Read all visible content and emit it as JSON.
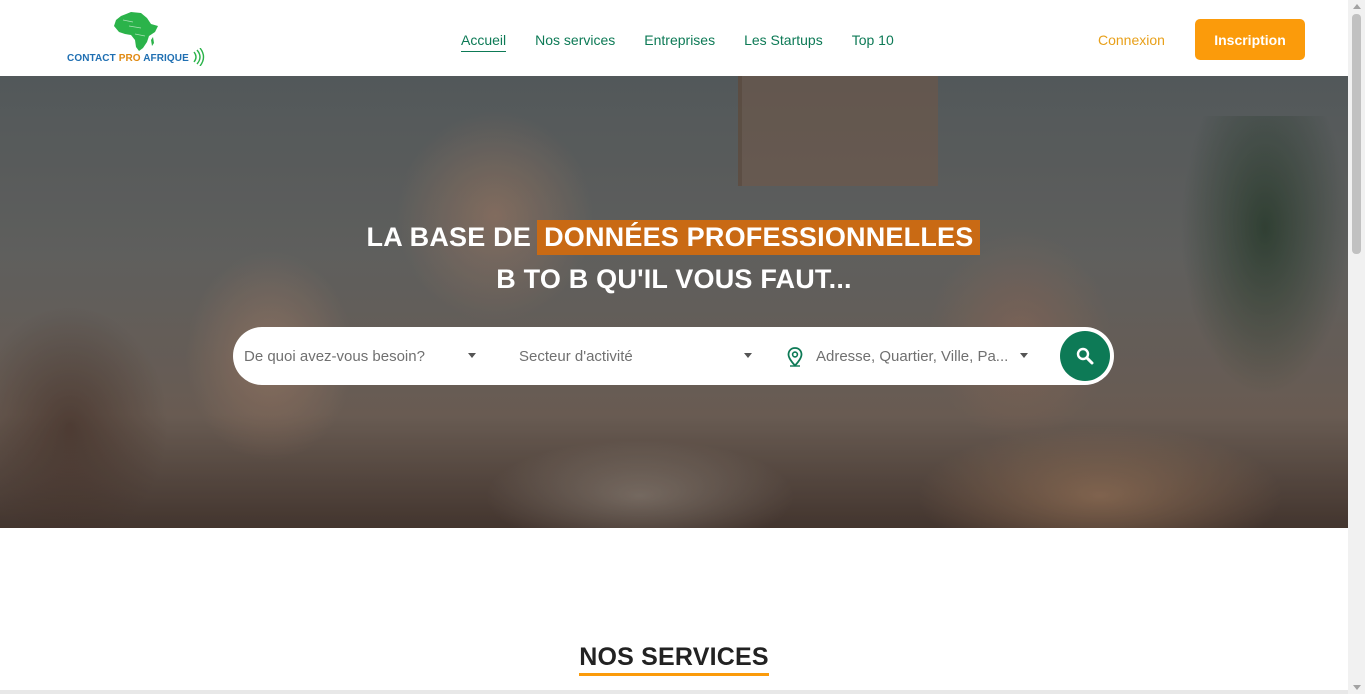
{
  "brand": {
    "part1": "CONTACT ",
    "part2": "PRO ",
    "part3": "AFRIQUE",
    "colors": {
      "green": "#2bb34a",
      "blue": "#1f6fb2",
      "orange": "#e08a12"
    }
  },
  "nav": {
    "items": [
      {
        "label": "Accueil",
        "active": true
      },
      {
        "label": "Nos services",
        "active": false
      },
      {
        "label": "Entreprises",
        "active": false
      },
      {
        "label": "Les Startups",
        "active": false
      },
      {
        "label": "Top 10",
        "active": false
      }
    ]
  },
  "auth": {
    "login_label": "Connexion",
    "signup_label": "Inscription"
  },
  "hero": {
    "headline_prefix": "LA BASE DE",
    "headline_highlight": "DONNÉES PROFESSIONNELLES",
    "headline_line2": "B TO B QU'IL VOUS FAUT..."
  },
  "search": {
    "need_placeholder": "De quoi avez-vous besoin?",
    "sector_placeholder": "Secteur d'activité",
    "location_placeholder": "Adresse, Quartier, Ville, Pa...",
    "location_icon": "map-pin-icon",
    "submit_icon": "search-icon"
  },
  "services": {
    "title": "NOS SERVICES"
  },
  "theme": {
    "primary_green": "#0d7a56",
    "accent_orange": "#fb9b0b",
    "highlight_orange": "#c96a14"
  }
}
